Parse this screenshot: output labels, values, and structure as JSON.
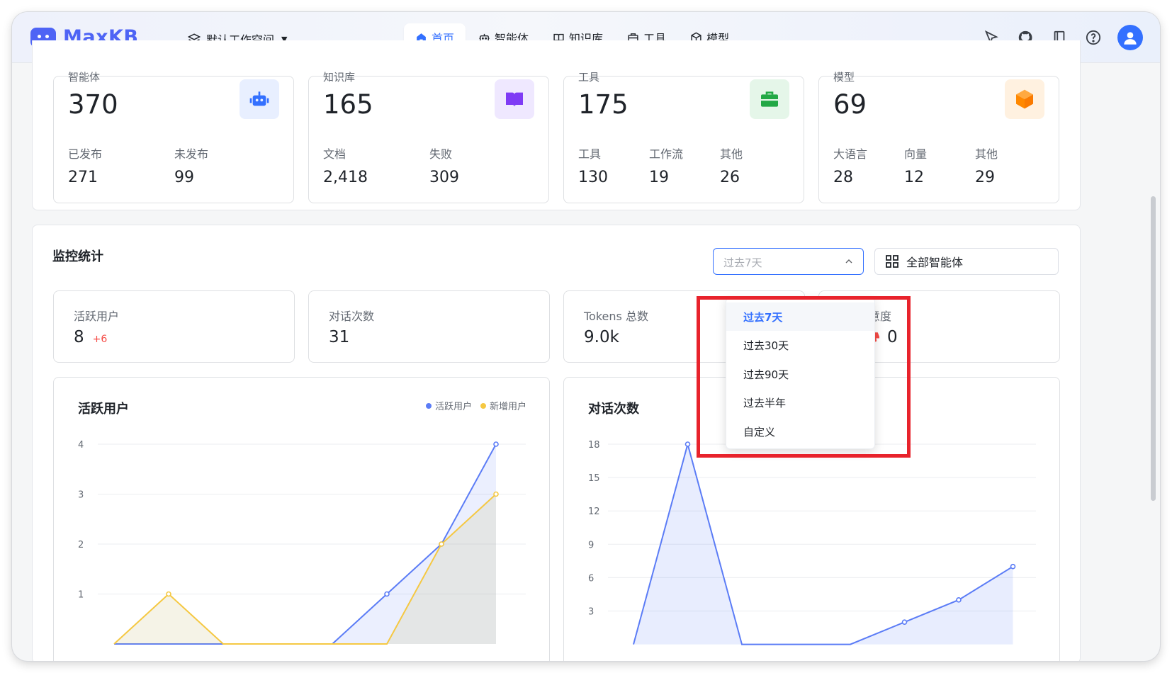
{
  "app": {
    "name": "MaxKB",
    "workspace": "默认工作空间"
  },
  "nav": [
    {
      "label": "首页",
      "icon": "home-icon",
      "active": true
    },
    {
      "label": "智能体",
      "icon": "robot-icon",
      "active": false
    },
    {
      "label": "知识库",
      "icon": "book-icon",
      "active": false
    },
    {
      "label": "工具",
      "icon": "toolbox-icon",
      "active": false
    },
    {
      "label": "模型",
      "icon": "cube-icon",
      "active": false
    }
  ],
  "header_icons": [
    "pointer-icon",
    "github-icon",
    "docs-icon",
    "help-icon",
    "user-avatar"
  ],
  "overview": {
    "cards": [
      {
        "title": "智能体",
        "total": "370",
        "icon": "robot-icon",
        "color": "#3370ff",
        "bg": "#e8efff",
        "subs": [
          {
            "label": "已发布",
            "value": "271"
          },
          {
            "label": "未发布",
            "value": "99"
          }
        ]
      },
      {
        "title": "知识库",
        "total": "165",
        "icon": "book-icon",
        "color": "#7f3bf5",
        "bg": "#efe8ff",
        "subs": [
          {
            "label": "文档",
            "value": "2,418"
          },
          {
            "label": "失败",
            "value": "309"
          }
        ]
      },
      {
        "title": "工具",
        "total": "175",
        "icon": "toolbox-icon",
        "color": "#22a845",
        "bg": "#e5f6e9",
        "subs": [
          {
            "label": "工具",
            "value": "130"
          },
          {
            "label": "工作流",
            "value": "19"
          },
          {
            "label": "其他",
            "value": "26"
          }
        ]
      },
      {
        "title": "模型",
        "total": "69",
        "icon": "cube-icon",
        "color": "#ff8800",
        "bg": "#fff1e0",
        "subs": [
          {
            "label": "大语言",
            "value": "28"
          },
          {
            "label": "向量",
            "value": "12"
          },
          {
            "label": "其他",
            "value": "29"
          }
        ]
      }
    ]
  },
  "monitor": {
    "title": "监控统计",
    "range_select": {
      "placeholder": "过去7天"
    },
    "agent_select": {
      "label": "全部智能体"
    },
    "metrics": [
      {
        "label": "活跃用户",
        "value": "8",
        "delta": "+6"
      },
      {
        "label": "对话次数",
        "value": "31",
        "delta": ""
      },
      {
        "label": "Tokens 总数",
        "value": "9.0k",
        "delta": ""
      },
      {
        "label": "满意度",
        "value": "0",
        "delta": ""
      }
    ],
    "dropdown": {
      "options": [
        "过去7天",
        "过去30天",
        "过去90天",
        "过去半年",
        "自定义"
      ],
      "selected": "过去7天"
    }
  },
  "chart_data": [
    {
      "type": "area",
      "title": "活跃用户",
      "ylim": [
        0,
        4
      ],
      "yticks": [
        1,
        2,
        3,
        4
      ],
      "x": [
        0,
        1,
        2,
        3,
        4,
        5,
        6,
        7
      ],
      "series": [
        {
          "name": "活跃用户",
          "color": "#5b7cf6",
          "values": [
            0,
            0,
            0,
            0,
            0,
            1,
            2,
            4
          ]
        },
        {
          "name": "新增用户",
          "color": "#f5c842",
          "values": [
            0,
            1,
            0,
            0,
            0,
            0,
            2,
            3
          ]
        }
      ]
    },
    {
      "type": "area",
      "title": "对话次数",
      "ylim": [
        0,
        18
      ],
      "yticks": [
        3,
        6,
        9,
        12,
        15,
        18
      ],
      "x": [
        0,
        1,
        2,
        3,
        4,
        5,
        6,
        7
      ],
      "series": [
        {
          "name": "对话次数",
          "color": "#5b7cf6",
          "values": [
            0,
            18,
            0,
            0,
            0,
            2,
            4,
            7
          ]
        }
      ]
    }
  ]
}
